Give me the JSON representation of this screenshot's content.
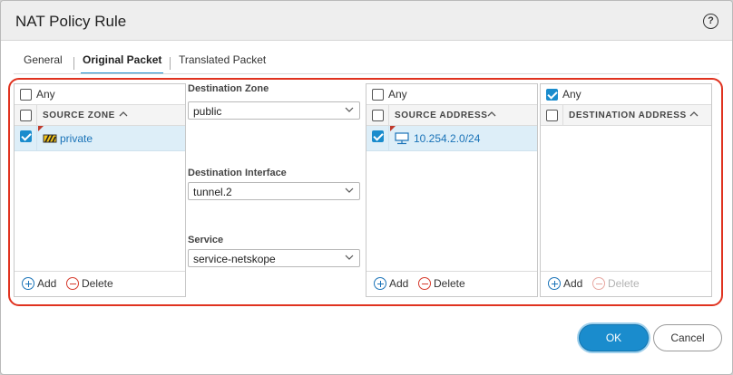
{
  "dialog": {
    "title": "NAT Policy Rule",
    "help_icon": "question-circle-icon",
    "help_glyph": "?"
  },
  "tabs": [
    {
      "label": "General",
      "active": false
    },
    {
      "label": "Original Packet",
      "active": true
    },
    {
      "label": "Translated Packet",
      "active": false
    }
  ],
  "source_zone": {
    "any_label": "Any",
    "any_checked": false,
    "column_title": "SOURCE ZONE",
    "rows": [
      {
        "label": "private",
        "checked": true,
        "icon": "zone-icon"
      }
    ],
    "add_label": "Add",
    "delete_label": "Delete"
  },
  "destination": {
    "zone_label": "Destination Zone",
    "zone_value": "public",
    "interface_label": "Destination Interface",
    "interface_value": "tunnel.2",
    "service_label": "Service",
    "service_value": "service-netskope"
  },
  "source_address": {
    "any_label": "Any",
    "any_checked": false,
    "column_title": "SOURCE ADDRESS",
    "rows": [
      {
        "label": "10.254.2.0/24",
        "checked": true,
        "icon": "network-address-icon"
      }
    ],
    "add_label": "Add",
    "delete_label": "Delete"
  },
  "destination_address": {
    "any_label": "Any",
    "any_checked": true,
    "column_title": "DESTINATION ADDRESS",
    "rows": [],
    "add_label": "Add",
    "delete_label": "Delete",
    "delete_disabled": true
  },
  "buttons": {
    "ok_label": "OK",
    "cancel_label": "Cancel"
  },
  "colors": {
    "accent": "#1a8ccd",
    "highlight_border": "#e0321f",
    "selected_row": "#ddeef8",
    "link_text": "#1a73b8"
  }
}
